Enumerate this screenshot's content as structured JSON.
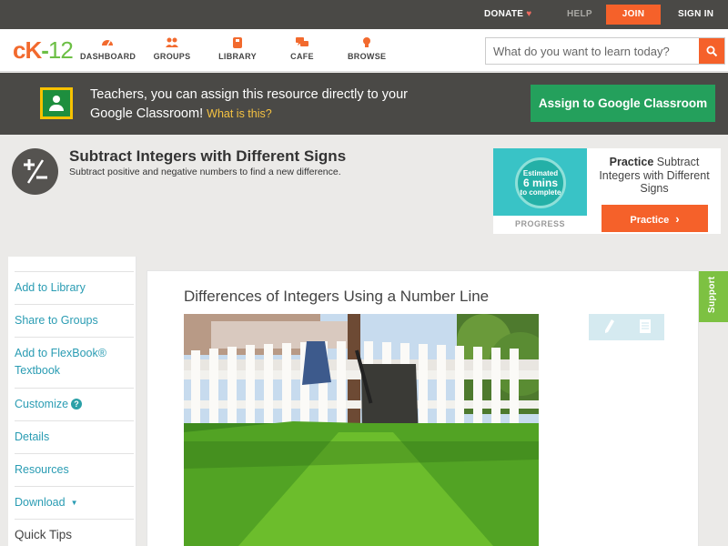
{
  "topbar": {
    "donate": "DONATE",
    "help": "HELP",
    "join": "JOIN",
    "signin": "SIGN IN"
  },
  "logo": {
    "c": "c",
    "k": "K",
    "dash": "-",
    "num": "12"
  },
  "nav": {
    "dashboard": "DASHBOARD",
    "groups": "GROUPS",
    "library": "LIBRARY",
    "cafe": "CAFE",
    "browse": "BROWSE"
  },
  "search": {
    "placeholder": "What do you want to learn today?"
  },
  "banner": {
    "text": "Teachers, you can assign this resource directly to your Google Classroom!",
    "what": "What is this?",
    "assign": "Assign to Google Classroom"
  },
  "concept": {
    "title": "Subtract Integers with Different Signs",
    "subtitle": "Subtract positive and negative numbers to find a new difference."
  },
  "practice": {
    "estimated": "Estimated",
    "mins": "6 mins",
    "to_complete": "to complete",
    "progress": "PROGRESS",
    "title_bold": "Practice",
    "title_rest": "Subtract Integers with Different Signs",
    "button": "Practice"
  },
  "sidebar": {
    "add_library": "Add to Library",
    "share_groups": "Share to Groups",
    "add_flexbook": "Add to FlexBook® Textbook",
    "customize": "Customize",
    "details": "Details",
    "resources": "Resources",
    "download": "Download",
    "quick_tips": "Quick Tips"
  },
  "main": {
    "title": "Differences of Integers Using a Number Line"
  },
  "support": "Support",
  "colors": {
    "accent_orange": "#f5612a",
    "green": "#24a05c",
    "link_blue": "#2a9cb3",
    "dark_bar": "#4a4946"
  }
}
